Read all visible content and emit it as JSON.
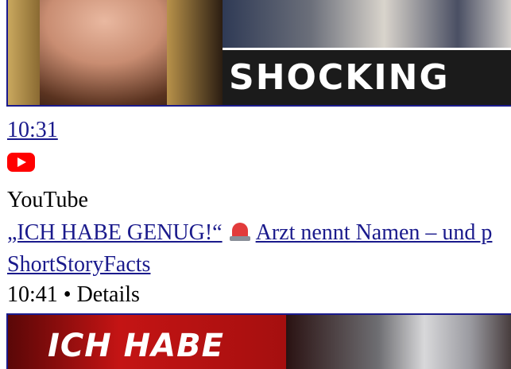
{
  "top_video": {
    "thumbnail_text": "SHOCKING",
    "duration": "10:31"
  },
  "source": {
    "icon": "youtube-icon",
    "name": "YouTube"
  },
  "video": {
    "title_start": "„ICH HABE GENUG!“",
    "title_emoji": "siren-icon",
    "title_end": "Arzt nennt Namen – und p",
    "channel": "ShortStoryFacts",
    "meta": "10:41 • Details",
    "thumbnail_text": "ICH HABE"
  },
  "colors": {
    "link": "#1a1a8c",
    "youtube_red": "#ff0000"
  }
}
